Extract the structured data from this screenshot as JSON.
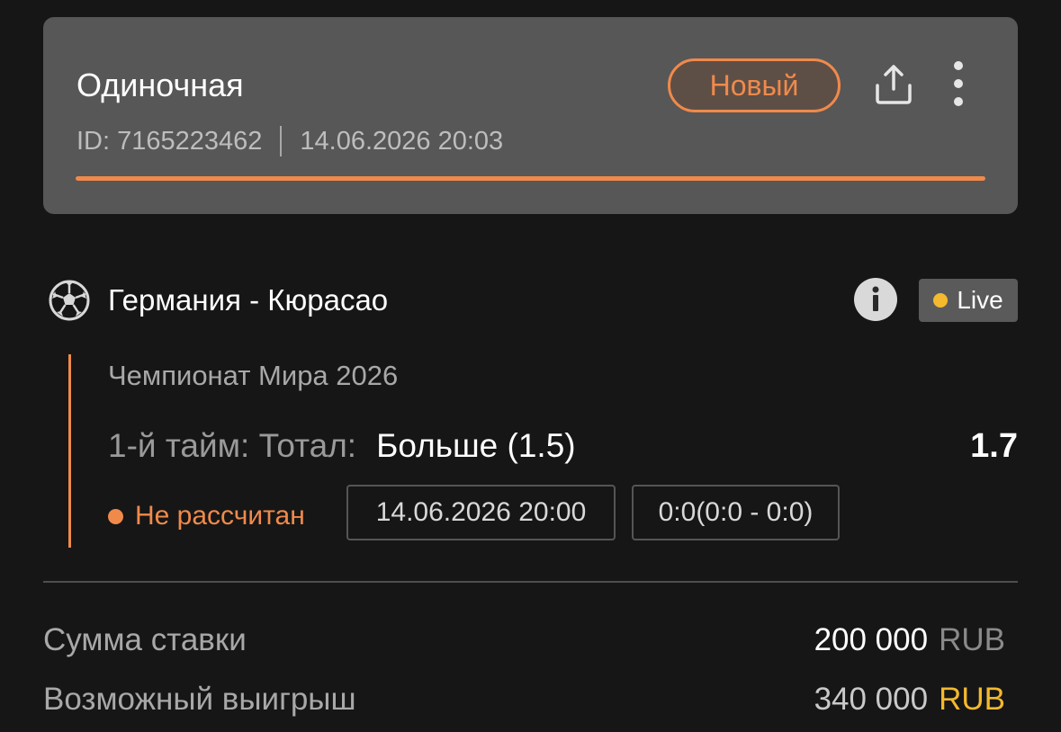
{
  "header": {
    "bet_type": "Одиночная",
    "id_label": "ID: 7165223462",
    "placed_at": "14.06.2026 20:03",
    "status": "Новый",
    "progress_percent": 100
  },
  "event": {
    "sport_icon": "soccer-ball-icon",
    "title": "Германия - Кюрасао",
    "live_label": "Live",
    "league": "Чемпионат Мира 2026",
    "market": "1-й тайм: Тотал:",
    "outcome": "Больше (1.5)",
    "odds": "1.7",
    "settle_status": "Не рассчитан",
    "start_time": "14.06.2026 20:00",
    "score": "0:0(0:0 - 0:0)"
  },
  "summary": {
    "stake_label": "Сумма ставки",
    "stake_amount": "200 000",
    "stake_currency": "RUB",
    "win_label": "Возможный выигрыш",
    "win_amount": "340 000",
    "win_currency": "RUB"
  },
  "colors": {
    "accent": "#f08a4b",
    "live_dot": "#f4b92e",
    "background": "#161616",
    "card": "#575757"
  }
}
